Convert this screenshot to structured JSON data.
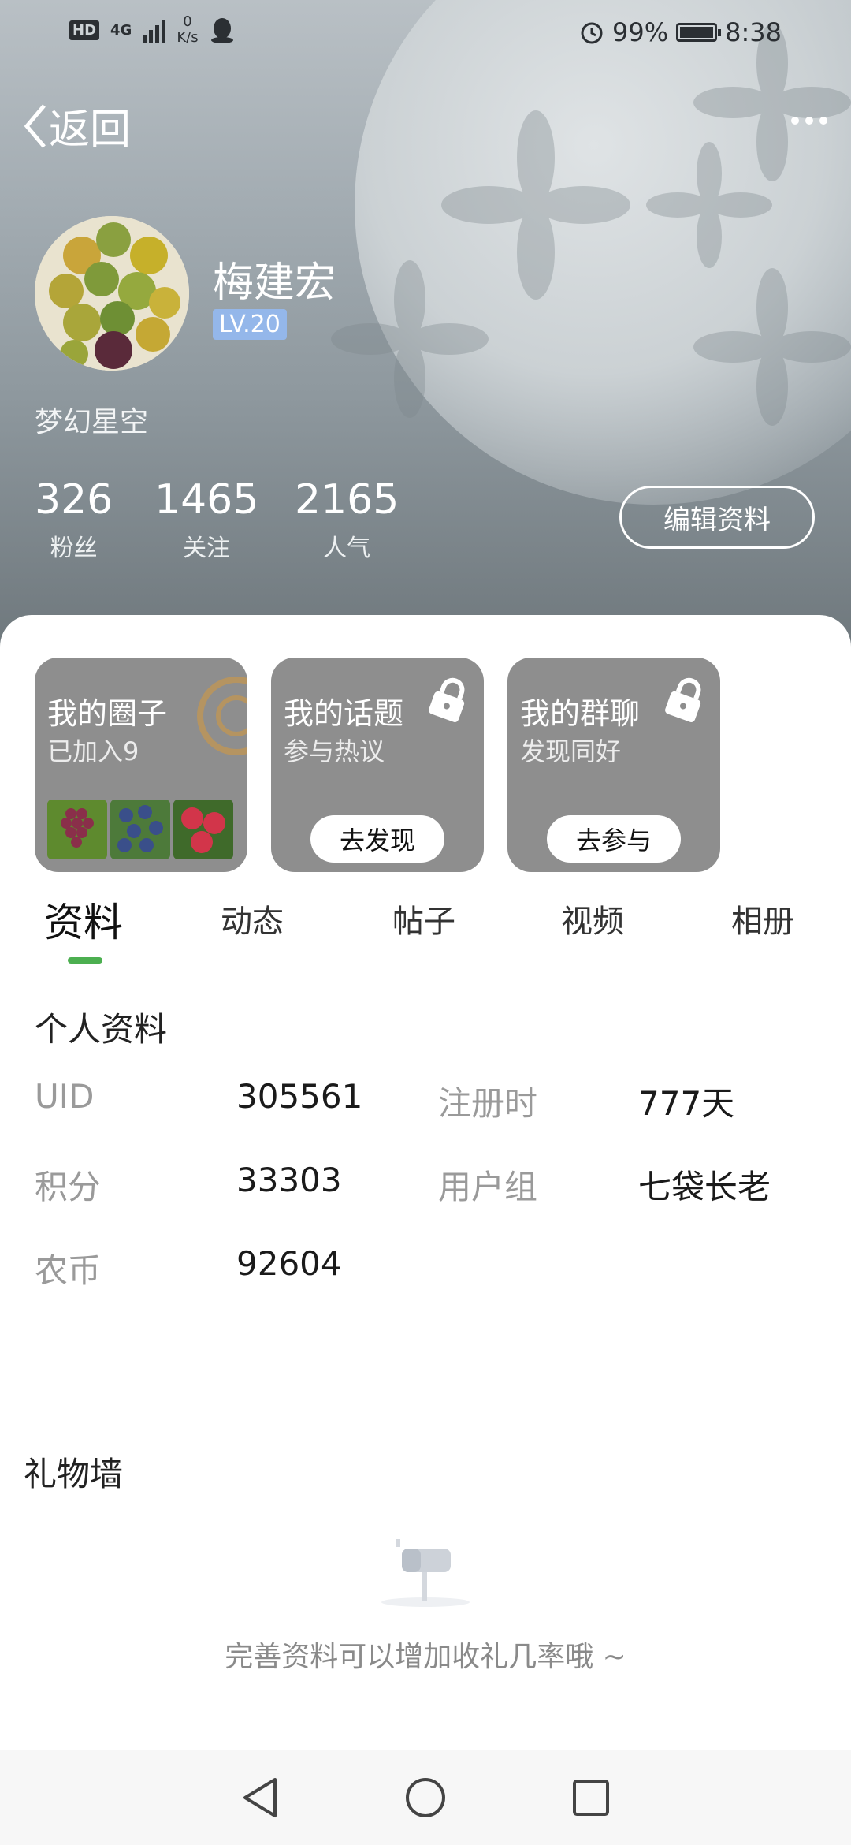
{
  "status_bar": {
    "hd": "HD",
    "network": "4G",
    "speed_value": "0",
    "speed_unit": "K/s",
    "battery": "99%",
    "time": "8:38"
  },
  "nav": {
    "back_label": "返回"
  },
  "profile": {
    "name": "梅建宏",
    "level": "LV.20",
    "signature": "梦幻星空",
    "stats": [
      {
        "value": "326",
        "label": "粉丝"
      },
      {
        "value": "1465",
        "label": "关注"
      },
      {
        "value": "2165",
        "label": "人气"
      }
    ],
    "edit_label": "编辑资料"
  },
  "cards": [
    {
      "title": "我的圈子",
      "subtitle": "已加入9"
    },
    {
      "title": "我的话题",
      "subtitle": "参与热议",
      "button": "去发现"
    },
    {
      "title": "我的群聊",
      "subtitle": "发现同好",
      "button": "去参与"
    }
  ],
  "tabs": [
    "资料",
    "动态",
    "帖子",
    "视频",
    "相册"
  ],
  "info": {
    "title": "个人资料",
    "rows": [
      {
        "k1": "UID",
        "v1": "305561",
        "k2": "注册时",
        "v2": "777天"
      },
      {
        "k1": "积分",
        "v1": "33303",
        "k2": "用户组",
        "v2": "七袋长老"
      },
      {
        "k1": "农币",
        "v1": "92604"
      }
    ]
  },
  "gift": {
    "title": "礼物墙",
    "empty_text": "完善资料可以增加收礼几率哦 ~"
  },
  "colors": {
    "accent": "#4caf50",
    "level_badge": "#94b7ea",
    "card_bg": "#8e8e8e"
  }
}
